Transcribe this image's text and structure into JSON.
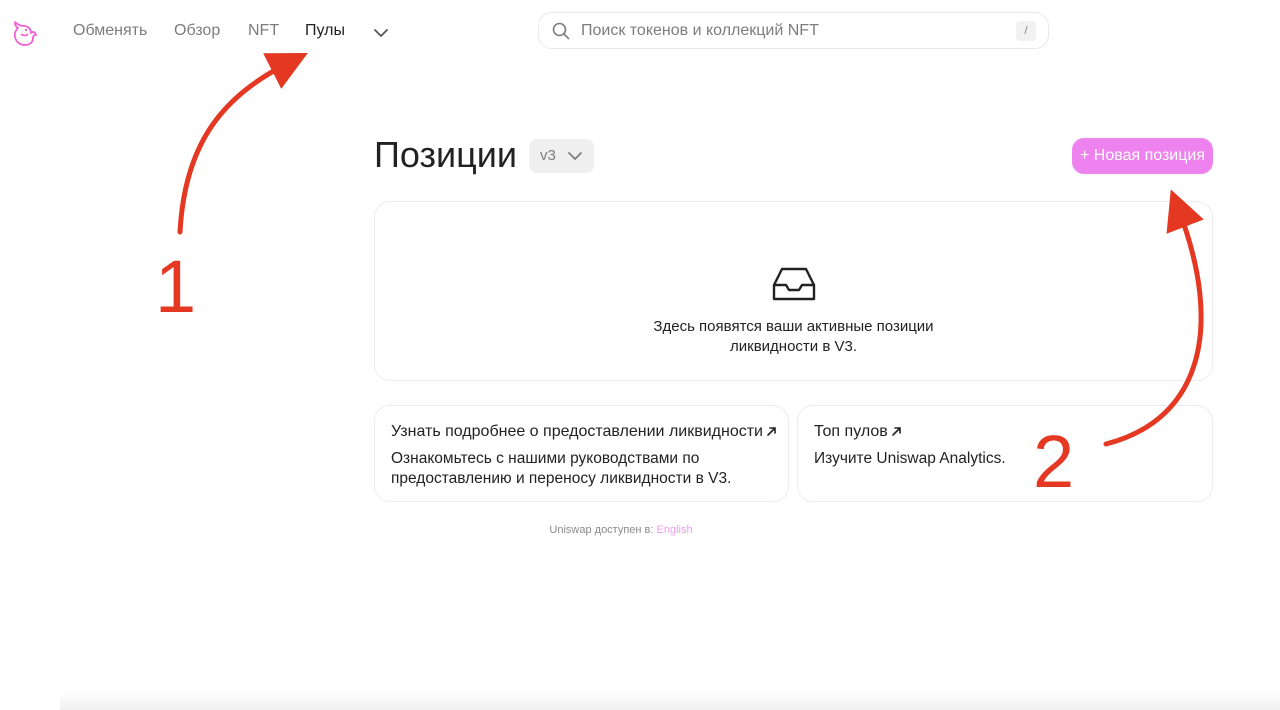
{
  "nav": {
    "items": [
      {
        "label": "Обменять",
        "active": false
      },
      {
        "label": "Обзор",
        "active": false
      },
      {
        "label": "NFT",
        "active": false
      },
      {
        "label": "Пулы",
        "active": true
      }
    ],
    "more_icon": "chevron-down-icon",
    "logo_icon": "uniswap-unicorn-logo"
  },
  "search": {
    "placeholder": "Поиск токенов и коллекций NFT",
    "value": "",
    "shortcut": "/"
  },
  "positions": {
    "title": "Позиции",
    "version": "v3",
    "new_position_label": "+ Новая позиция",
    "empty_text_line1": "Здесь появятся ваши активные позиции",
    "empty_text_line2": "ликвидности в V3."
  },
  "cards": {
    "learn": {
      "title": "Узнать подробнее о предоставлении ликвидности",
      "desc": "Ознакомьтесь с нашими руководствами по предоставлению и переносу ликвидности в V3."
    },
    "top_pools": {
      "title": "Топ пулов",
      "desc": "Изучите Uniswap Analytics."
    }
  },
  "footer": {
    "text": "Uniswap доступен в:",
    "link": "English"
  },
  "annotations": {
    "step1": "1",
    "step2": "2"
  },
  "colors": {
    "accent": "#ee82ee",
    "text": "#222222",
    "muted": "#7d7d7d",
    "annotation": "#e53822"
  }
}
